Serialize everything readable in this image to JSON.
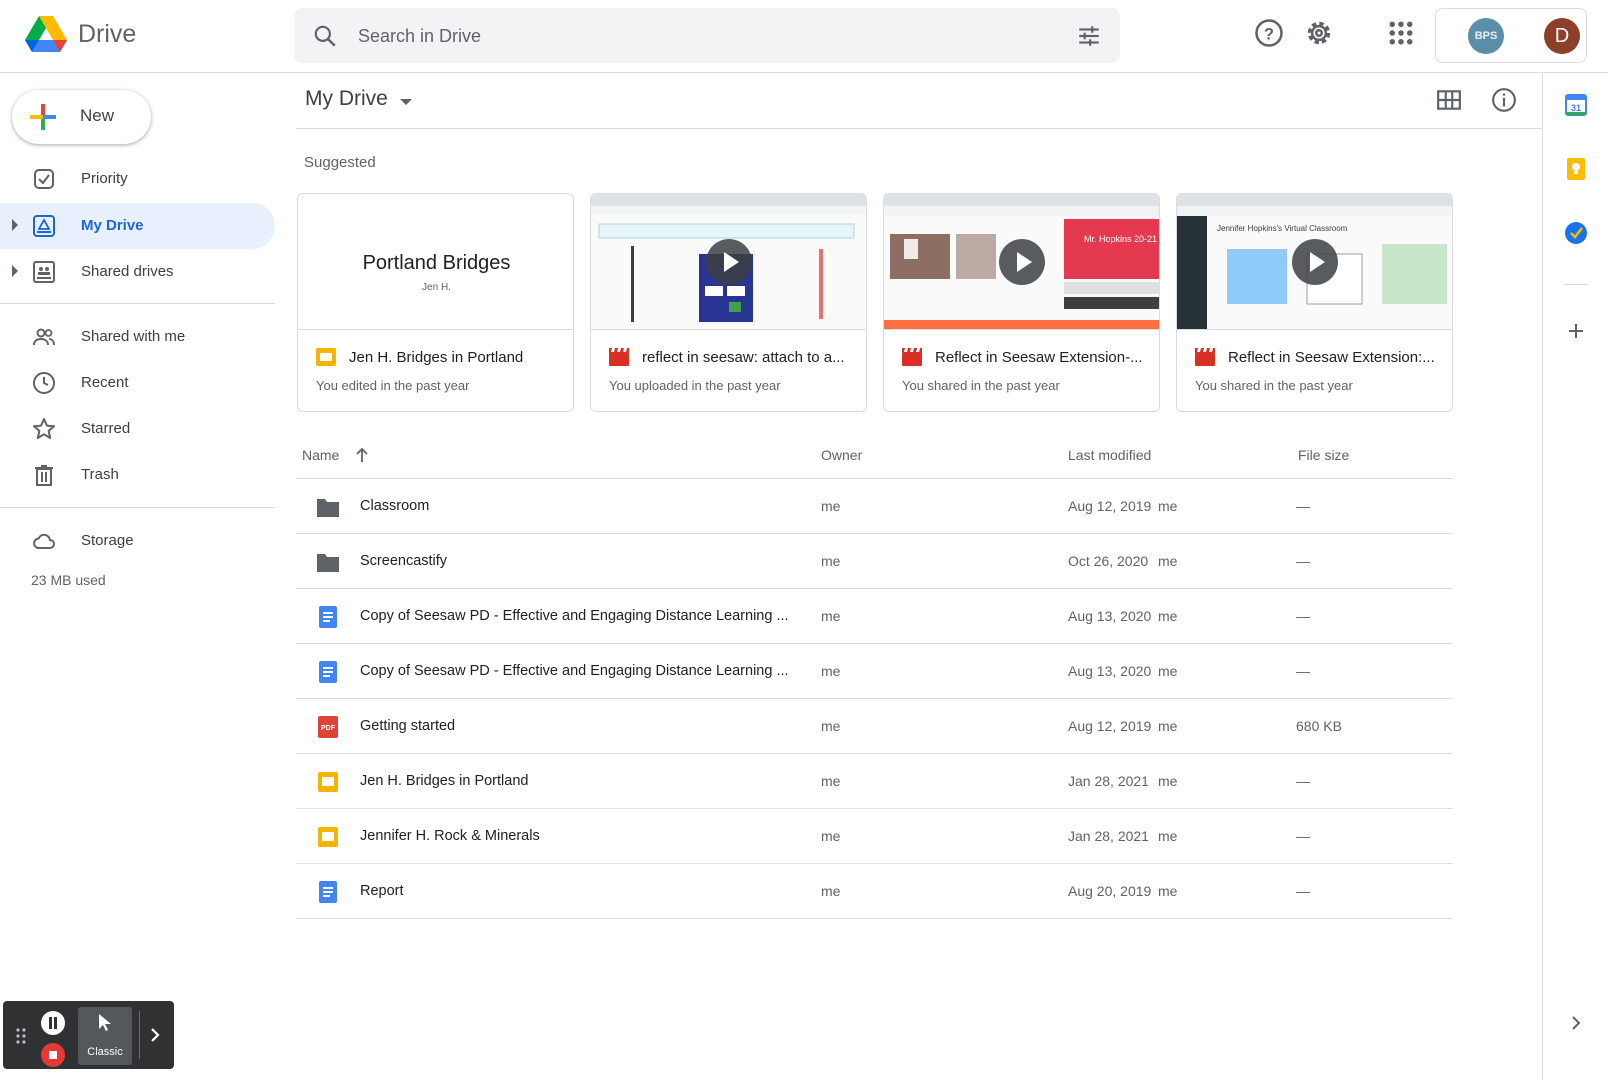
{
  "header": {
    "app_title": "Drive",
    "search_placeholder": "Search in Drive",
    "org_badge": "BPS",
    "avatar_initial": "D"
  },
  "sidebar": {
    "new_label": "New",
    "items": [
      {
        "label": "Priority",
        "icon": "priority-icon"
      },
      {
        "label": "My Drive",
        "icon": "my-drive-icon",
        "active": true
      },
      {
        "label": "Shared drives",
        "icon": "shared-drives-icon"
      },
      {
        "label": "Shared with me",
        "icon": "people-icon"
      },
      {
        "label": "Recent",
        "icon": "clock-icon"
      },
      {
        "label": "Starred",
        "icon": "star-icon"
      },
      {
        "label": "Trash",
        "icon": "trash-icon"
      },
      {
        "label": "Storage",
        "icon": "cloud-icon"
      }
    ],
    "storage_used": "23 MB used"
  },
  "content": {
    "title": "My Drive",
    "suggested_label": "Suggested"
  },
  "suggested": [
    {
      "name": "Jen H. Bridges in Portland",
      "subtitle": "You edited in the past year",
      "type": "slides",
      "thumb_title": "Portland Bridges",
      "thumb_author": "Jen H."
    },
    {
      "name": "reflect in seesaw: attach to a...",
      "subtitle": "You uploaded in the past year",
      "type": "video"
    },
    {
      "name": "Reflect in Seesaw Extension-...",
      "subtitle": "You shared in the past year",
      "type": "video",
      "thumb_text": "Mr. Hopkins 20-21"
    },
    {
      "name": "Reflect in Seesaw Extension:...",
      "subtitle": "You shared in the past year",
      "type": "video",
      "thumb_text": "Jennifer Hopkins's Virtual Classroom"
    }
  ],
  "table": {
    "columns": {
      "name": "Name",
      "owner": "Owner",
      "modified": "Last modified",
      "size": "File size"
    },
    "rows": [
      {
        "name": "Classroom",
        "type": "folder",
        "owner": "me",
        "modified": "Aug 12, 2019",
        "by": "me",
        "size": "—"
      },
      {
        "name": "Screencastify",
        "type": "folder",
        "owner": "me",
        "modified": "Oct 26, 2020",
        "by": "me",
        "size": "—"
      },
      {
        "name": "Copy of Seesaw PD - Effective and Engaging Distance Learning ...",
        "type": "doc",
        "owner": "me",
        "modified": "Aug 13, 2020",
        "by": "me",
        "size": "—"
      },
      {
        "name": "Copy of Seesaw PD - Effective and Engaging Distance Learning ...",
        "type": "doc",
        "owner": "me",
        "modified": "Aug 13, 2020",
        "by": "me",
        "size": "—"
      },
      {
        "name": "Getting started",
        "type": "pdf",
        "owner": "me",
        "modified": "Aug 12, 2019",
        "by": "me",
        "size": "680 KB"
      },
      {
        "name": "Jen H. Bridges in Portland",
        "type": "slides",
        "owner": "me",
        "modified": "Jan 28, 2021",
        "by": "me",
        "size": "—"
      },
      {
        "name": "Jennifer H. Rock & Minerals",
        "type": "slides",
        "owner": "me",
        "modified": "Jan 28, 2021",
        "by": "me",
        "size": "—"
      },
      {
        "name": "Report",
        "type": "doc",
        "owner": "me",
        "modified": "Aug 20, 2019",
        "by": "me",
        "size": "—"
      }
    ]
  },
  "side_panel": [
    "calendar-icon",
    "keep-icon",
    "tasks-icon",
    "add-icon",
    "chevron-right-icon"
  ],
  "recorder": {
    "mode_label": "Classic"
  },
  "colors": {
    "accent": "#1967d2",
    "active_bg": "#e8f0fe",
    "slides_yellow": "#f4b400",
    "docs_blue": "#4285f4",
    "pdf_red": "#db4437",
    "video_red": "#d93025"
  }
}
